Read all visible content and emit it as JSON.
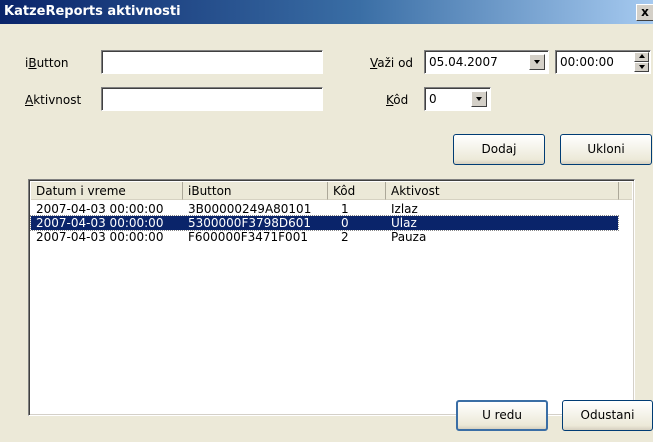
{
  "window": {
    "title": "KatzeReports aktivnosti",
    "close_glyph": "x"
  },
  "form": {
    "ibutton_label_pre": "i",
    "ibutton_label_acc": "B",
    "ibutton_label_post": "utton",
    "ibutton_value": "",
    "aktivnost_label_acc": "A",
    "aktivnost_label_post": "ktivnost",
    "aktivnost_value": "",
    "vazi_od_label_acc": "V",
    "vazi_od_label_post": "aži od",
    "date_value": "05.04.2007",
    "time_value": "00:00:00",
    "kod_label_acc": "K",
    "kod_label_post": "ôd",
    "kod_value": "0"
  },
  "buttons": {
    "dodaj": "Dodaj",
    "ukloni": "Ukloni",
    "ok": "U redu",
    "cancel": "Odustani"
  },
  "table": {
    "columns": [
      "Datum i vreme",
      "iButton",
      "Kôd",
      "Aktivost"
    ],
    "rows": [
      {
        "datum": "2007-04-03 00:00:00",
        "ibutton": "3B00000249A80101",
        "kod": "1",
        "aktivost": "Izlaz",
        "selected": false
      },
      {
        "datum": "2007-04-03 00:00:00",
        "ibutton": "5300000F3798D601",
        "kod": "0",
        "aktivost": "Ulaz",
        "selected": true
      },
      {
        "datum": "2007-04-03 00:00:00",
        "ibutton": "F600000F3471F001",
        "kod": "2",
        "aktivost": "Pauza",
        "selected": false
      }
    ]
  },
  "colors": {
    "titlebar_start": "#0a246a",
    "dialog_bg": "#ece9d8",
    "selection": "#0a246a"
  }
}
